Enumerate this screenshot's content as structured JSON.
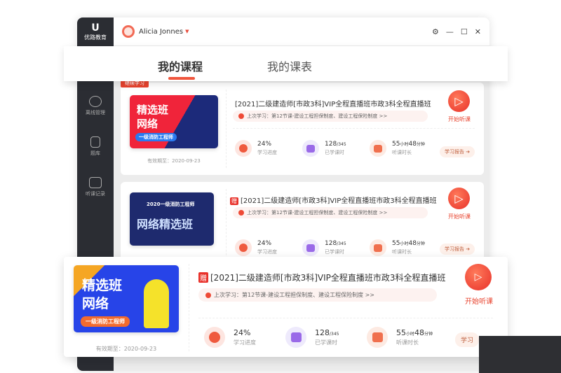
{
  "app": {
    "logo_text": "优路教育",
    "user": "Alicia Jonnes"
  },
  "sidebar": {
    "items": [
      {
        "label": "离线管理"
      },
      {
        "label": "题库"
      },
      {
        "label": "听课记录"
      }
    ]
  },
  "tabs": [
    {
      "label": "我的课程"
    },
    {
      "label": "我的课表"
    }
  ],
  "badge": "继续学习",
  "courses": [
    {
      "thumb_title1": "精选班",
      "thumb_title2": "网络",
      "thumb_sub": "一级消防工程师",
      "valid": "有效期至：2020-09-23",
      "gift": "",
      "title": "[2021]二级建造师[市政3科]VIP全程直播班市政3科全程直播班",
      "last": "上次学习：第12节课-建设工程担保制度、建设工程保险制度 >>",
      "play": "开始听课",
      "progress": "24%",
      "progress_label": "学习进度",
      "done": "128",
      "total": "/345",
      "done_label": "已学课时",
      "hours": "55",
      "hours_unit": "小时",
      "mins": "48",
      "mins_unit": "分钟",
      "time_label": "听课时长",
      "report": "学习报告"
    },
    {
      "thumb_title1": "2020一级消防工程师",
      "thumb_title2": "网络精选班",
      "valid": "",
      "gift": "赠",
      "title": "[2021]二级建造师[市政3科]VIP全程直播班市政3科全程直播班",
      "last": "上次学习：第12节课-建设工程担保制度、建设工程保险制度 >>",
      "play": "开始听课",
      "progress": "24%",
      "progress_label": "学习进度",
      "done": "128",
      "total": "/345",
      "done_label": "已学课时",
      "hours": "55",
      "hours_unit": "小时",
      "mins": "48",
      "mins_unit": "分钟",
      "time_label": "听课时长",
      "report": "学习报告"
    },
    {
      "thumb_title1": "精选班",
      "thumb_title2": "网络",
      "thumb_sub": "一级消防工程师",
      "valid": "有效期至：2020-09-23",
      "gift": "赠",
      "title": "[2021]二级建造师[市政3科]VIP全程直播班市政3科全程直播班",
      "last": "上次学习：第12节课-建设工程担保制度、建设工程保险制度 >>",
      "play": "开始听课",
      "progress": "24%",
      "progress_label": "学习进度",
      "done": "128",
      "total": "/345",
      "done_label": "已学课时",
      "hours": "55",
      "hours_unit": "小时",
      "mins": "48",
      "mins_unit": "分钟",
      "time_label": "听课时长",
      "report": "学习"
    }
  ]
}
